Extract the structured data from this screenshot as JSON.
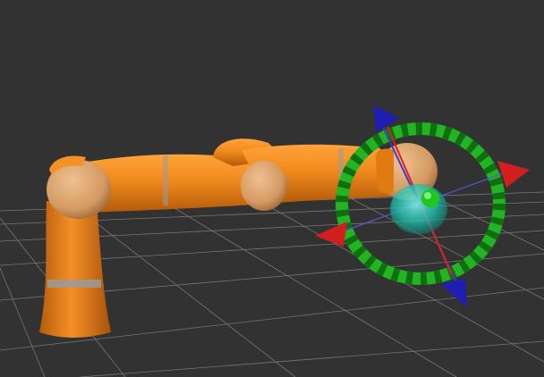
{
  "viewport": {
    "background": "#323232",
    "grid_color": "#8c8c8c"
  },
  "robot": {
    "body_color": "#f08a1e",
    "body_shade": "#b45a0a",
    "joint_color": "#d9a06a",
    "band_color": "#9a9a9a"
  },
  "gizmo": {
    "ring_color": "#22b422",
    "ring_stripe": "#0f6e0f",
    "x_axis_color": "#d21e1e",
    "y_axis_color": "#1e1eb4",
    "z_axis_color": "#1e96d2",
    "center_sphere_color": "#20c8b4",
    "center_marker_color": "#1ec81e",
    "icons": [
      "x-axis-arrow-icon",
      "y-axis-arrow-icon",
      "rotation-ring-icon"
    ]
  }
}
